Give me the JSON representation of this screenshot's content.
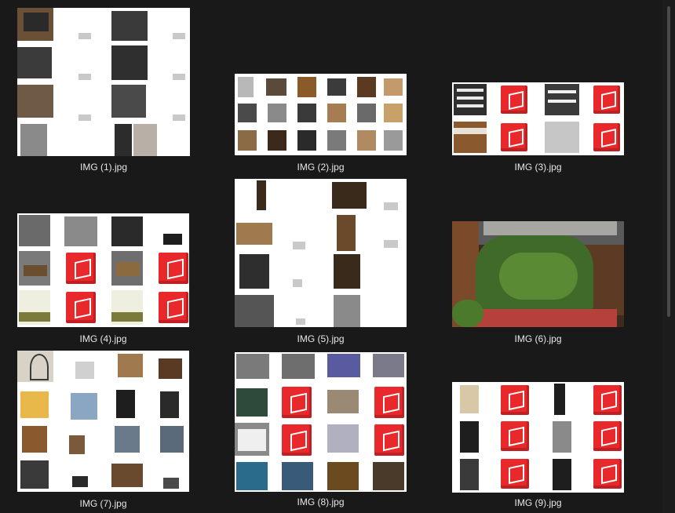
{
  "window": {
    "background": "#191919"
  },
  "files": [
    {
      "id": 1,
      "name": "IMG (1).jpg"
    },
    {
      "id": 2,
      "name": "IMG (2).jpg"
    },
    {
      "id": 3,
      "name": "IMG (3).jpg"
    },
    {
      "id": 4,
      "name": "IMG (4).jpg"
    },
    {
      "id": 5,
      "name": "IMG (5).jpg"
    },
    {
      "id": 6,
      "name": "IMG (6).jpg"
    },
    {
      "id": 7,
      "name": "IMG (7).jpg"
    },
    {
      "id": 8,
      "name": "IMG (8).jpg"
    },
    {
      "id": 9,
      "name": "IMG (9).jpg"
    }
  ],
  "colors": {
    "sketchup_red": "#e8282b",
    "caption": "#e6e6e6"
  }
}
